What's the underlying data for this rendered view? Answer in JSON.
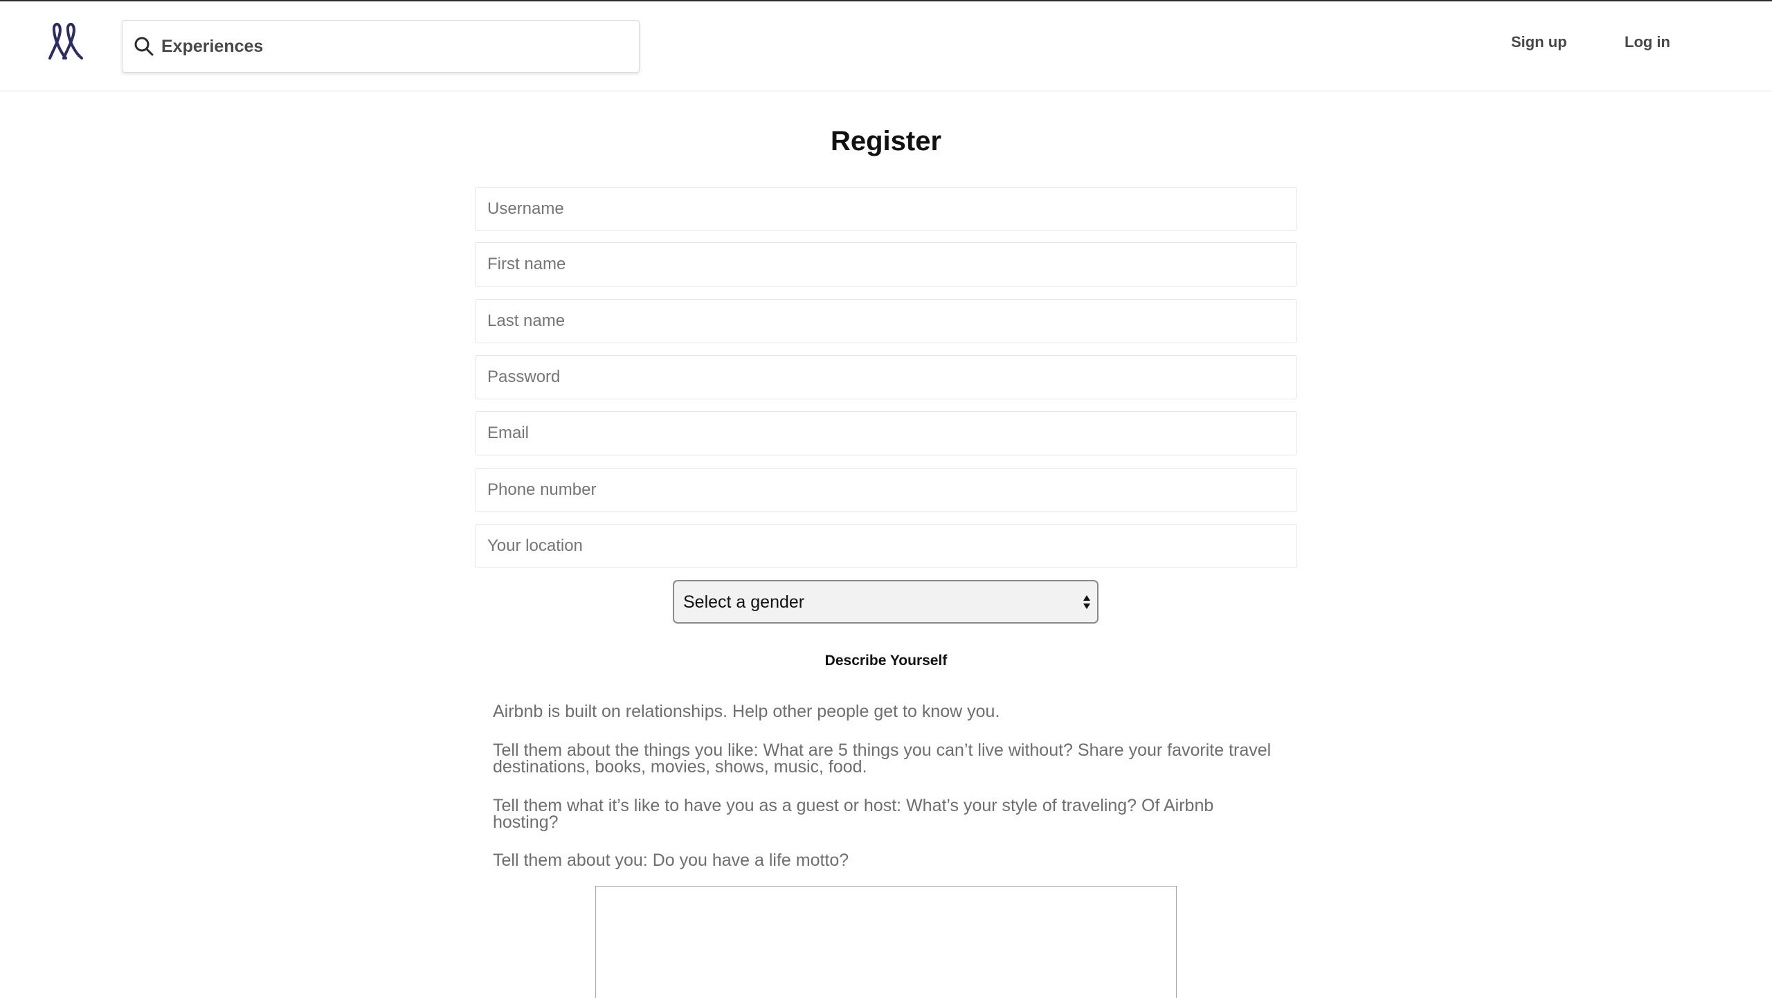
{
  "header": {
    "logo_icon": "airbnb-experiences-logo",
    "search": {
      "icon": "search-icon",
      "value": "Experiences",
      "placeholder": ""
    },
    "nav": {
      "signup_label": "Sign up",
      "login_label": "Log in"
    }
  },
  "form": {
    "title": "Register",
    "fields": {
      "username": {
        "placeholder": "Username"
      },
      "first_name": {
        "placeholder": "First name"
      },
      "last_name": {
        "placeholder": "Last name"
      },
      "password": {
        "placeholder": "Password"
      },
      "email": {
        "placeholder": "Email"
      },
      "phone": {
        "placeholder": "Phone number"
      },
      "location": {
        "placeholder": "Your location"
      }
    },
    "gender_select": {
      "selected": "Select a gender"
    },
    "describe": {
      "heading": "Describe Yourself",
      "paragraphs": [
        "Airbnb is built on relationships. Help other people get to know you.",
        "Tell them about the things you like: What are 5 things you can’t live without? Share your favorite travel destinations, books, movies, shows, music, food.",
        "Tell them what it’s like to have you as a guest or host: What’s your style of traveling? Of Airbnb hosting?",
        "Tell them about you: Do you have a life motto?"
      ],
      "bio_value": ""
    }
  },
  "colors": {
    "logo": "#2b2a6b",
    "text_dark": "#484848",
    "muted_text": "#6e6e6e"
  }
}
